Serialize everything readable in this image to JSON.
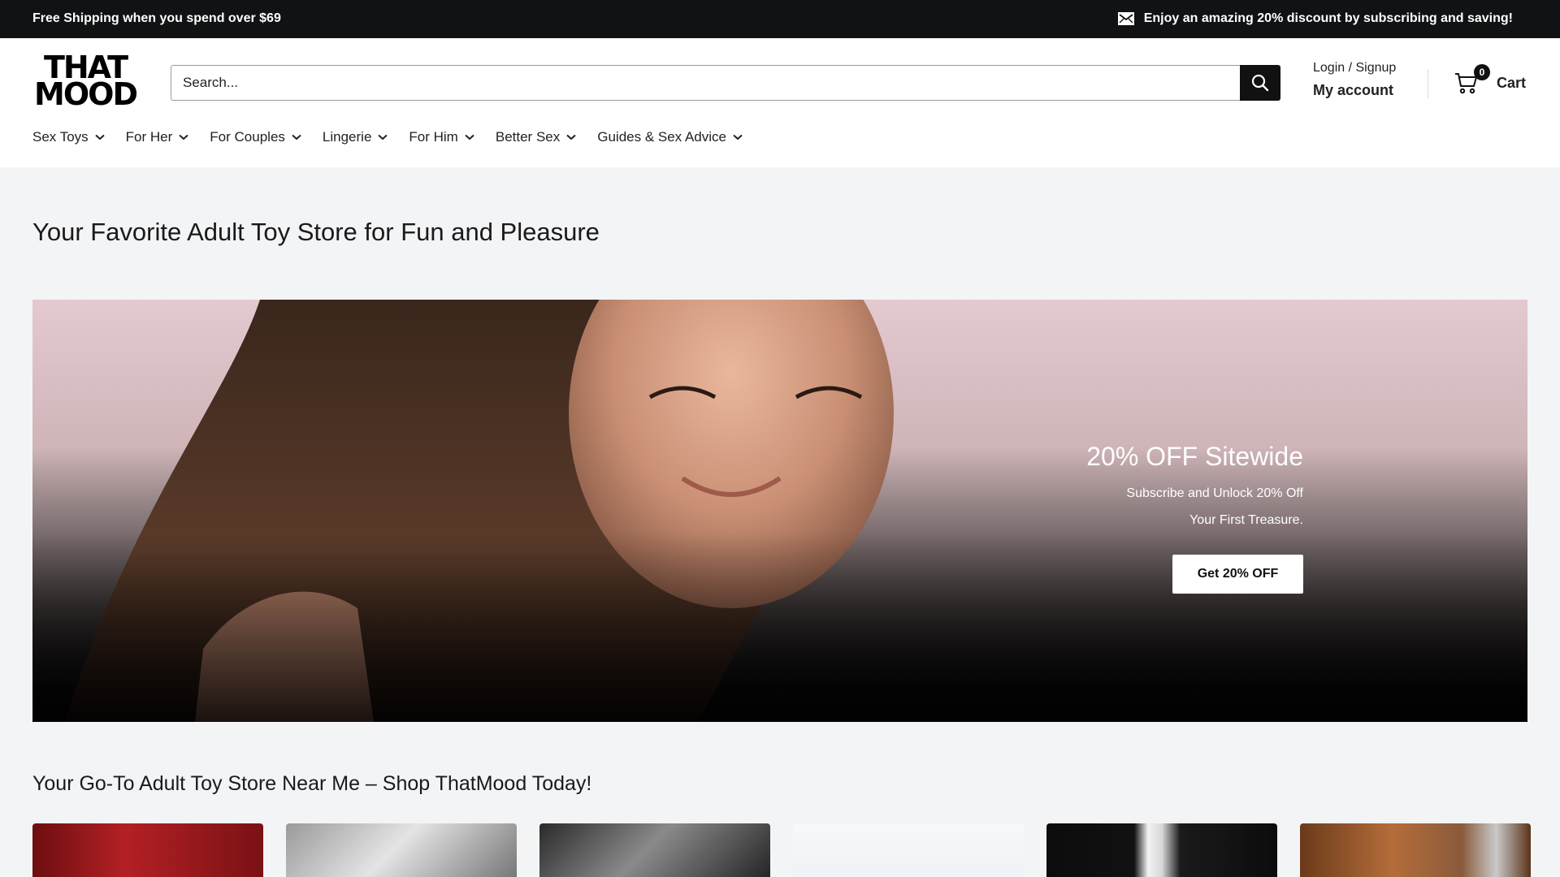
{
  "announcement": {
    "left_text": "Free Shipping when you spend over $69",
    "right_text": "Enjoy an amazing 20% discount by subscribing and saving!",
    "right_icon": "mail-icon"
  },
  "header": {
    "logo_line1": "THAT",
    "logo_line2": "MOOD",
    "search_placeholder": "Search...",
    "search_icon": "search-icon",
    "login_label": "Login / Signup",
    "account_label": "My account",
    "cart_count": "0",
    "cart_label": "Cart"
  },
  "nav": {
    "items": [
      {
        "label": "Sex Toys"
      },
      {
        "label": "For Her"
      },
      {
        "label": "For Couples"
      },
      {
        "label": "Lingerie"
      },
      {
        "label": "For Him"
      },
      {
        "label": "Better Sex"
      },
      {
        "label": "Guides & Sex Advice"
      }
    ]
  },
  "main": {
    "page_title": "Your Favorite Adult Toy Store for Fun and Pleasure",
    "hero": {
      "title": "20% OFF Sitewide",
      "subtitle_line1": "Subscribe and Unlock 20% Off",
      "subtitle_line2": "Your First Treasure.",
      "button_label": "Get 20% OFF"
    },
    "section_title": "Your Go-To Adult Toy Store Near Me – Shop ThatMood Today!"
  },
  "colors": {
    "announcement_bg": "#111213",
    "accent": "#111111",
    "page_bg": "#f3f4f6"
  }
}
